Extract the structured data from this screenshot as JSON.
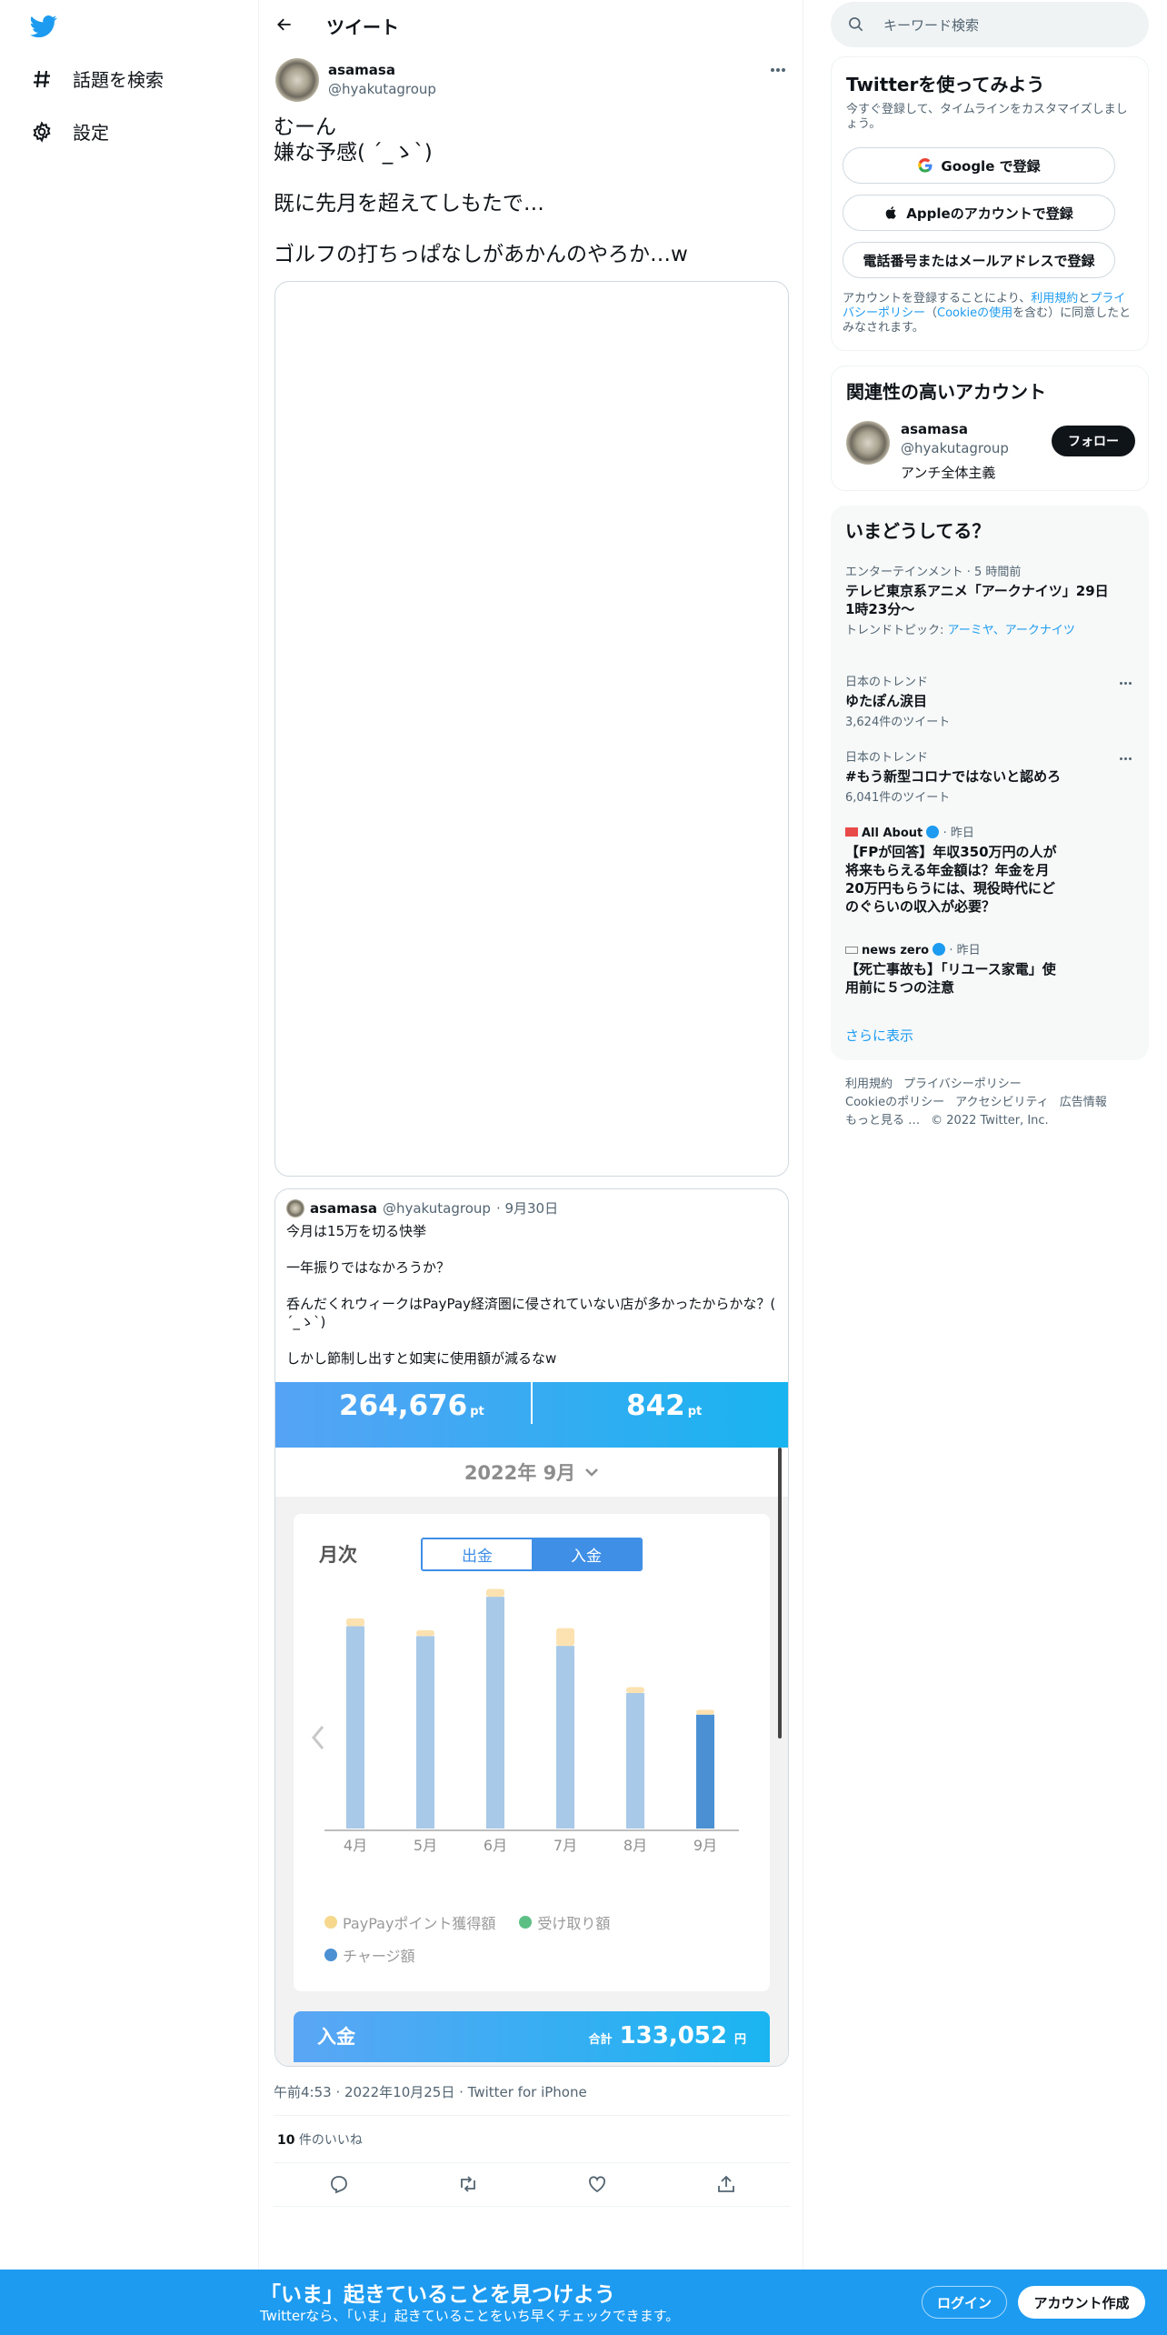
{
  "nav": {
    "explore_label": "話題を検索",
    "settings_label": "設定"
  },
  "header": {
    "title": "ツイート"
  },
  "tweet": {
    "author_name": "asamasa",
    "author_handle": "@hyakutagroup",
    "text": "むーん\n嫌な予感( ´_ゝ`)\n\n既に先月を超えてしもたで…\n\nゴルフの打ちっぱなしがあかんのやろか…w",
    "meta": "午前4:53 · 2022年10月25日 · Twitter for iPhone",
    "likes_count": "10",
    "likes_label": " 件のいいね"
  },
  "quote": {
    "author_name": "asamasa",
    "author_handle": "@hyakutagroup",
    "date": "· 9月30日",
    "text": "今月は15万を切る快挙\n\n一年振りではなかろうか？\n\n呑んだくれウィークはPayPay経済圏に侵されていない店が多かったからかな？( ´_ゝ`)\n\nしかし節制し出すと如実に使用額が減るなw",
    "image": {
      "points_left": "264,676",
      "points_right": "842",
      "points_unit": "pt",
      "month_label": "2022年 9月",
      "card_title": "月次",
      "tab_out": "出金",
      "tab_in": "入金",
      "legend": {
        "paypay_points": "PayPayポイント獲得額",
        "received": "受け取り額",
        "charge": "チャージ額"
      },
      "bottom_label": "入金",
      "total_label": "合計",
      "total_value": "133,052",
      "total_unit": "円",
      "colors": {
        "charge_bar": "#a9c9e8",
        "charge_selected": "#4a90d2",
        "points_bar": "#fbe2b0",
        "received": "#5cbf84",
        "accent": "#3f8fe6"
      }
    }
  },
  "chart_data": {
    "type": "bar",
    "categories": [
      "4月",
      "5月",
      "6月",
      "7月",
      "8月",
      "9月"
    ],
    "series": [
      {
        "name": "チャージ額",
        "values": [
          206,
          196,
          236,
          186,
          138,
          116
        ]
      },
      {
        "name": "PayPayポイント獲得額",
        "values": [
          8,
          6,
          8,
          18,
          6,
          5
        ]
      }
    ],
    "selected_category": "9月",
    "stacked": true,
    "ylim": [
      0,
      250
    ],
    "grid": false,
    "legend_position": "bottom"
  },
  "right": {
    "search_placeholder": "キーワード検索",
    "signup": {
      "title": "Twitterを使ってみよう",
      "subtitle": "今すぐ登録して、タイムラインをカスタマイズしましょう。",
      "google_label": "Google で登録",
      "apple_label": "Appleのアカウントで登録",
      "phone_label": "電話番号またはメールアドレスで登録",
      "legal_prefix": "アカウントを登録することにより、",
      "legal_terms": "利用規約",
      "legal_and": "と",
      "legal_privacy": "プライバシーポリシー",
      "legal_paren_open": "（",
      "legal_cookie": "Cookieの使用",
      "legal_suffix": "を含む）に同意したとみなされます。"
    },
    "relevant": {
      "title": "関連性の高いアカウント",
      "name": "asamasa",
      "handle": "@hyakutagroup",
      "bio": "アンチ全体主義",
      "follow_label": "フォロー"
    },
    "trends": {
      "title": "いまどうしてる？",
      "items": [
        {
          "context": "エンターテインメント · 5 時間前",
          "title": "テレビ東京系アニメ「アークナイツ」29日1時23分〜",
          "topic_prefix": "トレンドトピック: ",
          "topic_links": "アーミヤ、アークナイツ"
        },
        {
          "context": "日本のトレンド",
          "title": "ゆたぽん涙目",
          "count": "3,624件のツイート"
        },
        {
          "context": "日本のトレンド",
          "title": "#もう新型コロナではないと認めろ",
          "count": "6,041件のツイート"
        },
        {
          "source": "All About",
          "time": "· 昨日",
          "title": "【FPが回答】年収350万円の人が将来もらえる年金額は？年金を月20万円もらうには、現役時代にどのぐらいの収入が必要？"
        },
        {
          "source": "news zero",
          "time": "· 昨日",
          "title": "【死亡事故も】「リユース家電」使用前に５つの注意"
        }
      ],
      "show_more": "さらに表示"
    },
    "footer": {
      "terms": "利用規約",
      "privacy": "プライバシーポリシー",
      "cookie": "Cookieのポリシー",
      "accessibility": "アクセシビリティ",
      "ads": "広告情報",
      "more": "もっと見る …",
      "copyright": "© 2022 Twitter, Inc."
    }
  },
  "bottom_bar": {
    "title": "「いま」起きていることを見つけよう",
    "subtitle": "Twitterなら、「いま」起きていることをいち早くチェックできます。",
    "login_label": "ログイン",
    "signup_label": "アカウント作成"
  }
}
